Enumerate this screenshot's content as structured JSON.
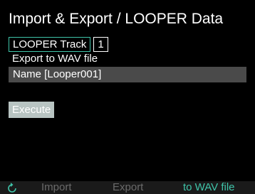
{
  "title": "Import & Export / LOOPER Data",
  "track": {
    "label": "LOOPER Track",
    "number": "1"
  },
  "export_line": "Export to WAV file",
  "name_field": "Name [Looper001]",
  "execute_label": "Execute",
  "footer": {
    "refresh_icon": "refresh-icon",
    "import_label": "Import",
    "export_label": "Export",
    "wav_label": "to WAV file"
  },
  "colors": {
    "accent": "#3fc4a9",
    "background": "#000000",
    "highlight_bar": "#4a4a4a",
    "button": "#b8c4c2",
    "inactive": "#6a6a6a"
  }
}
